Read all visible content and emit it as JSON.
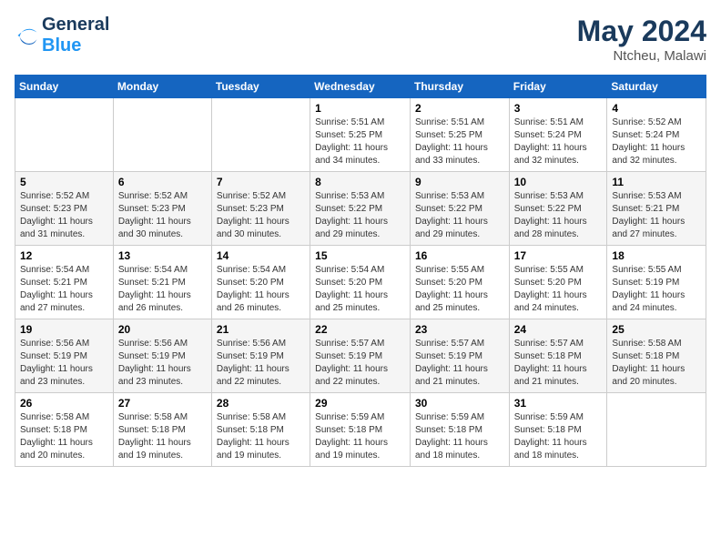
{
  "header": {
    "logo_line1": "General",
    "logo_line2": "Blue",
    "month": "May 2024",
    "location": "Ntcheu, Malawi"
  },
  "weekdays": [
    "Sunday",
    "Monday",
    "Tuesday",
    "Wednesday",
    "Thursday",
    "Friday",
    "Saturday"
  ],
  "weeks": [
    [
      {
        "day": "",
        "info": ""
      },
      {
        "day": "",
        "info": ""
      },
      {
        "day": "",
        "info": ""
      },
      {
        "day": "1",
        "info": "Sunrise: 5:51 AM\nSunset: 5:25 PM\nDaylight: 11 hours\nand 34 minutes."
      },
      {
        "day": "2",
        "info": "Sunrise: 5:51 AM\nSunset: 5:25 PM\nDaylight: 11 hours\nand 33 minutes."
      },
      {
        "day": "3",
        "info": "Sunrise: 5:51 AM\nSunset: 5:24 PM\nDaylight: 11 hours\nand 32 minutes."
      },
      {
        "day": "4",
        "info": "Sunrise: 5:52 AM\nSunset: 5:24 PM\nDaylight: 11 hours\nand 32 minutes."
      }
    ],
    [
      {
        "day": "5",
        "info": "Sunrise: 5:52 AM\nSunset: 5:23 PM\nDaylight: 11 hours\nand 31 minutes."
      },
      {
        "day": "6",
        "info": "Sunrise: 5:52 AM\nSunset: 5:23 PM\nDaylight: 11 hours\nand 30 minutes."
      },
      {
        "day": "7",
        "info": "Sunrise: 5:52 AM\nSunset: 5:23 PM\nDaylight: 11 hours\nand 30 minutes."
      },
      {
        "day": "8",
        "info": "Sunrise: 5:53 AM\nSunset: 5:22 PM\nDaylight: 11 hours\nand 29 minutes."
      },
      {
        "day": "9",
        "info": "Sunrise: 5:53 AM\nSunset: 5:22 PM\nDaylight: 11 hours\nand 29 minutes."
      },
      {
        "day": "10",
        "info": "Sunrise: 5:53 AM\nSunset: 5:22 PM\nDaylight: 11 hours\nand 28 minutes."
      },
      {
        "day": "11",
        "info": "Sunrise: 5:53 AM\nSunset: 5:21 PM\nDaylight: 11 hours\nand 27 minutes."
      }
    ],
    [
      {
        "day": "12",
        "info": "Sunrise: 5:54 AM\nSunset: 5:21 PM\nDaylight: 11 hours\nand 27 minutes."
      },
      {
        "day": "13",
        "info": "Sunrise: 5:54 AM\nSunset: 5:21 PM\nDaylight: 11 hours\nand 26 minutes."
      },
      {
        "day": "14",
        "info": "Sunrise: 5:54 AM\nSunset: 5:20 PM\nDaylight: 11 hours\nand 26 minutes."
      },
      {
        "day": "15",
        "info": "Sunrise: 5:54 AM\nSunset: 5:20 PM\nDaylight: 11 hours\nand 25 minutes."
      },
      {
        "day": "16",
        "info": "Sunrise: 5:55 AM\nSunset: 5:20 PM\nDaylight: 11 hours\nand 25 minutes."
      },
      {
        "day": "17",
        "info": "Sunrise: 5:55 AM\nSunset: 5:20 PM\nDaylight: 11 hours\nand 24 minutes."
      },
      {
        "day": "18",
        "info": "Sunrise: 5:55 AM\nSunset: 5:19 PM\nDaylight: 11 hours\nand 24 minutes."
      }
    ],
    [
      {
        "day": "19",
        "info": "Sunrise: 5:56 AM\nSunset: 5:19 PM\nDaylight: 11 hours\nand 23 minutes."
      },
      {
        "day": "20",
        "info": "Sunrise: 5:56 AM\nSunset: 5:19 PM\nDaylight: 11 hours\nand 23 minutes."
      },
      {
        "day": "21",
        "info": "Sunrise: 5:56 AM\nSunset: 5:19 PM\nDaylight: 11 hours\nand 22 minutes."
      },
      {
        "day": "22",
        "info": "Sunrise: 5:57 AM\nSunset: 5:19 PM\nDaylight: 11 hours\nand 22 minutes."
      },
      {
        "day": "23",
        "info": "Sunrise: 5:57 AM\nSunset: 5:19 PM\nDaylight: 11 hours\nand 21 minutes."
      },
      {
        "day": "24",
        "info": "Sunrise: 5:57 AM\nSunset: 5:18 PM\nDaylight: 11 hours\nand 21 minutes."
      },
      {
        "day": "25",
        "info": "Sunrise: 5:58 AM\nSunset: 5:18 PM\nDaylight: 11 hours\nand 20 minutes."
      }
    ],
    [
      {
        "day": "26",
        "info": "Sunrise: 5:58 AM\nSunset: 5:18 PM\nDaylight: 11 hours\nand 20 minutes."
      },
      {
        "day": "27",
        "info": "Sunrise: 5:58 AM\nSunset: 5:18 PM\nDaylight: 11 hours\nand 19 minutes."
      },
      {
        "day": "28",
        "info": "Sunrise: 5:58 AM\nSunset: 5:18 PM\nDaylight: 11 hours\nand 19 minutes."
      },
      {
        "day": "29",
        "info": "Sunrise: 5:59 AM\nSunset: 5:18 PM\nDaylight: 11 hours\nand 19 minutes."
      },
      {
        "day": "30",
        "info": "Sunrise: 5:59 AM\nSunset: 5:18 PM\nDaylight: 11 hours\nand 18 minutes."
      },
      {
        "day": "31",
        "info": "Sunrise: 5:59 AM\nSunset: 5:18 PM\nDaylight: 11 hours\nand 18 minutes."
      },
      {
        "day": "",
        "info": ""
      }
    ]
  ]
}
